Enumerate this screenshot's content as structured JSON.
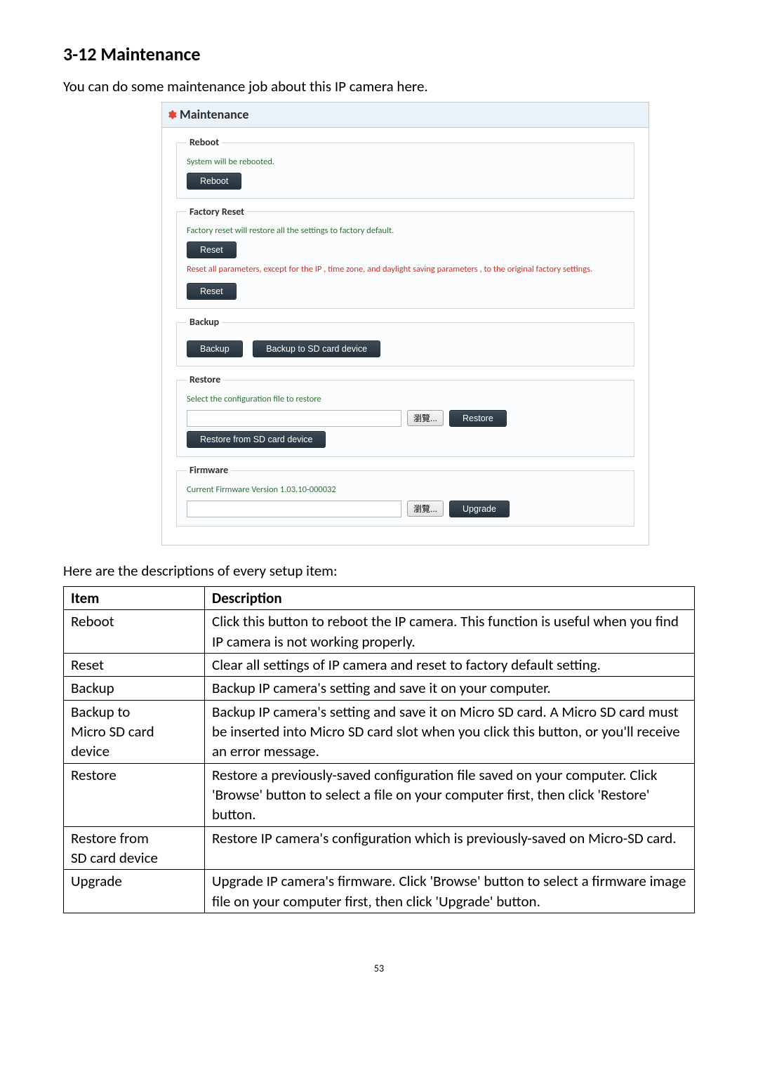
{
  "section": {
    "heading": "3-12 Maintenance"
  },
  "intro": "You can do some maintenance job about this IP camera here.",
  "panel": {
    "title": "Maintenance",
    "reboot": {
      "legend": "Reboot",
      "text": "System will be rebooted.",
      "button": "Reboot"
    },
    "factory_reset": {
      "legend": "Factory Reset",
      "text1": "Factory reset will restore all the settings to factory default.",
      "button1": "Reset",
      "text2": "Reset all parameters,  except for the IP , time zone, and daylight saving parameters , to the original factory settings.",
      "button2": "Reset"
    },
    "backup": {
      "legend": "Backup",
      "button1": "Backup",
      "button2": "Backup to SD card device"
    },
    "restore": {
      "legend": "Restore",
      "text": "Select the configuration file to restore",
      "browse": "瀏覽...",
      "button1": "Restore",
      "button2": "Restore from SD card device"
    },
    "firmware": {
      "legend": "Firmware",
      "text": "Current Firmware Version  1.03.10-000032",
      "browse": "瀏覽...",
      "button": "Upgrade"
    }
  },
  "table_intro": "Here are the descriptions of every setup item:",
  "table": {
    "header_item": "Item",
    "header_desc": "Description",
    "rows": [
      {
        "item": "Reboot",
        "desc": "Click this button to reboot the IP camera. This function is useful when you find IP camera is not working properly."
      },
      {
        "item": "Reset",
        "desc": "Clear all settings of IP camera and reset to factory default setting."
      },
      {
        "item": "Backup",
        "desc": "Backup IP camera's setting and save it on your computer."
      },
      {
        "item_lines": [
          "Backup to",
          "Micro SD card",
          "device"
        ],
        "desc": "Backup IP camera's setting and save it on Micro SD card. A Micro SD card must be inserted into Micro SD card slot when you click this button, or you'll receive an error message."
      },
      {
        "item": "Restore",
        "desc": "Restore a previously-saved configuration file saved on your computer. Click 'Browse' button to select a file on your computer first, then click 'Restore' button."
      },
      {
        "item_lines": [
          "Restore from",
          "SD card device"
        ],
        "desc": "Restore IP camera's configuration which is previously-saved on Micro-SD card."
      },
      {
        "item": "Upgrade",
        "desc": "Upgrade IP camera's firmware. Click 'Browse' button to select a firmware image file on your computer first, then click 'Upgrade' button."
      }
    ]
  },
  "page_number": "53"
}
